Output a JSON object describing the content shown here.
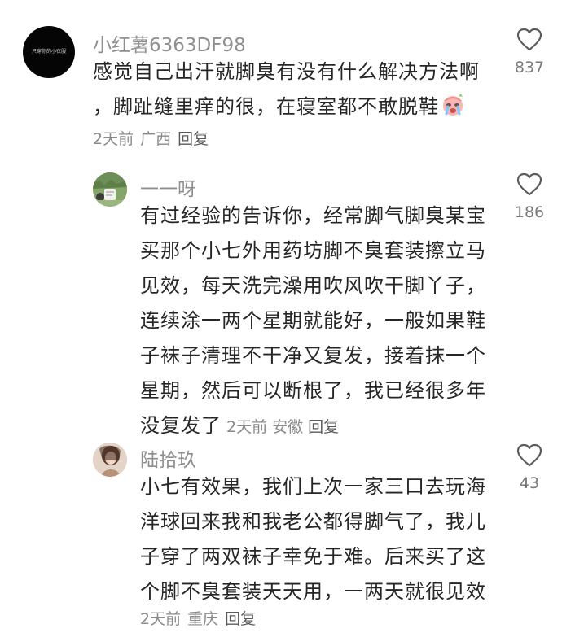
{
  "comments": [
    {
      "username": "小红薯6363DF98",
      "avatar_text": "只穿你的小衣服",
      "text_lines": [
        "感觉自己出汗就脚臭有没有什么解决方法啊",
        "，脚趾缝里痒的很，在寝室都不敢脱鞋"
      ],
      "emoji": "crying-face",
      "time": "2天前",
      "location": "广西",
      "reply_label": "回复",
      "likes": "837"
    },
    {
      "username": "一一呀",
      "text_lines": [
        "有过经验的告诉你，经常脚气脚臭某宝",
        "买那个小七外用药坊脚不臭套装擦立马",
        "见效，每天洗完澡用吹风吹干脚丫子，",
        "连续涂一两个星期就能好，一般如果鞋",
        "子袜子清理不干净又复发，接着抹一个",
        "星期，然后可以断根了，我已经很多年",
        "没复发了"
      ],
      "time": "2天前",
      "location": "安徽",
      "reply_label": "回复",
      "likes": "186"
    },
    {
      "username": "陆拾玖",
      "text_lines": [
        "小七有效果，我们上次一家三口去玩海",
        "洋球回来我和我老公都得脚气了，我儿",
        "子穿了两双袜子幸免于难。后来买了这",
        "个脚不臭套装天天用，一两天就很见效"
      ],
      "time": "2天前",
      "location": "重庆",
      "reply_label": "回复",
      "likes": "43"
    }
  ]
}
